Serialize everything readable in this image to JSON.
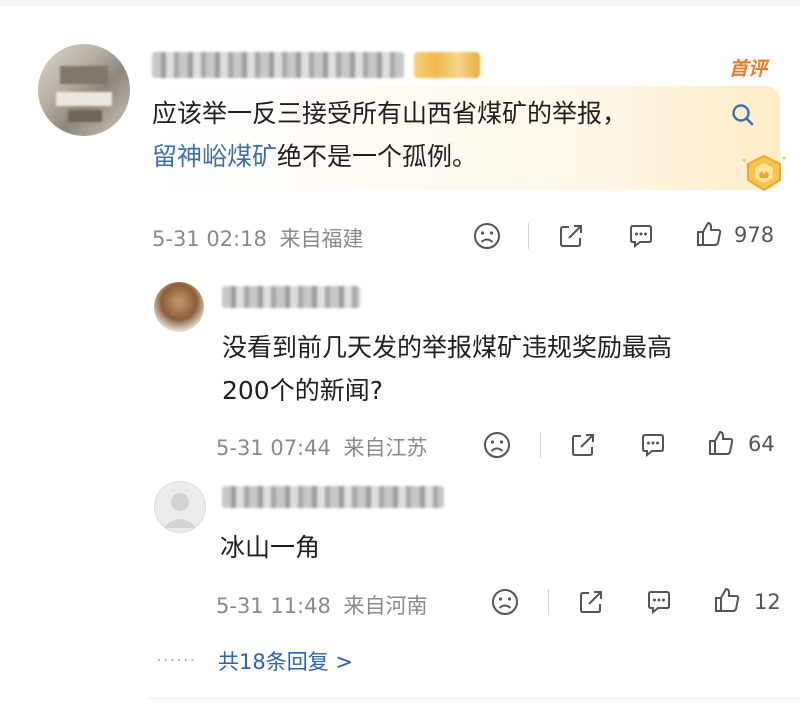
{
  "comment": {
    "hot_tag": "首评",
    "text_line1": "应该举一反三接受所有山西省煤矿的举报，",
    "link_text": "留神峪煤矿",
    "text_line2_rest": "绝不是一个孤例。",
    "time": "5-31 02:18",
    "location": "来自福建",
    "likes": "978"
  },
  "replies": [
    {
      "text_line1": "没看到前几天发的举报煤矿违规奖励最高",
      "text_line2": "200个的新闻?",
      "time": "5-31 07:44",
      "location": "来自江苏",
      "likes": "64"
    },
    {
      "text_line1": "冰山一角",
      "time": "5-31 11:48",
      "location": "来自河南",
      "likes": "12"
    }
  ],
  "more_replies": {
    "dots": "······",
    "label": "共18条回复 >"
  },
  "icons": {
    "search": "search-icon",
    "crown": "crown-badge-icon",
    "sad": "sad-face-icon",
    "share": "share-icon",
    "comment": "comment-icon",
    "like": "thumbs-up-icon"
  },
  "colors": {
    "link": "#3d6fb3",
    "hot": "#f07a2a",
    "meta": "#8a8a8a",
    "more": "#2e63ad"
  }
}
